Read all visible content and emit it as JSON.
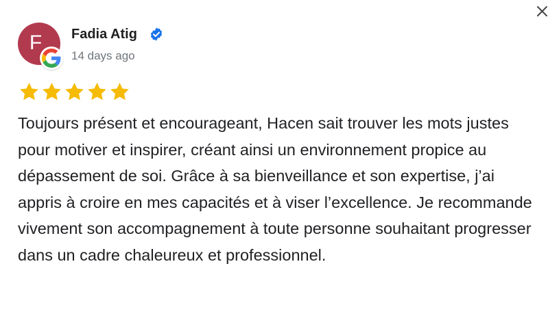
{
  "reviewer": {
    "name": "Fadia Atig",
    "avatar_letter": "F",
    "avatar_color": "#b23a4f",
    "verified_icon": "verified-badge-icon",
    "date": "14 days ago",
    "source_icon": "google-g-icon"
  },
  "rating": {
    "stars": 5,
    "max": 5,
    "star_color": "#f6bb06"
  },
  "review": {
    "text": "Toujours présent et encourageant, Hacen sait trouver les mots justes pour motiver et inspirer, créant ainsi un environnement propice au dépassement de soi. Grâce à sa bienveillance et son expertise, j’ai appris à croire en mes capacités et à viser l’excellence. Je recommande vivement son accompagnement à toute personne souhaitant progresser dans un cadre chaleureux et professionnel."
  },
  "controls": {
    "close_icon": "close-icon"
  }
}
